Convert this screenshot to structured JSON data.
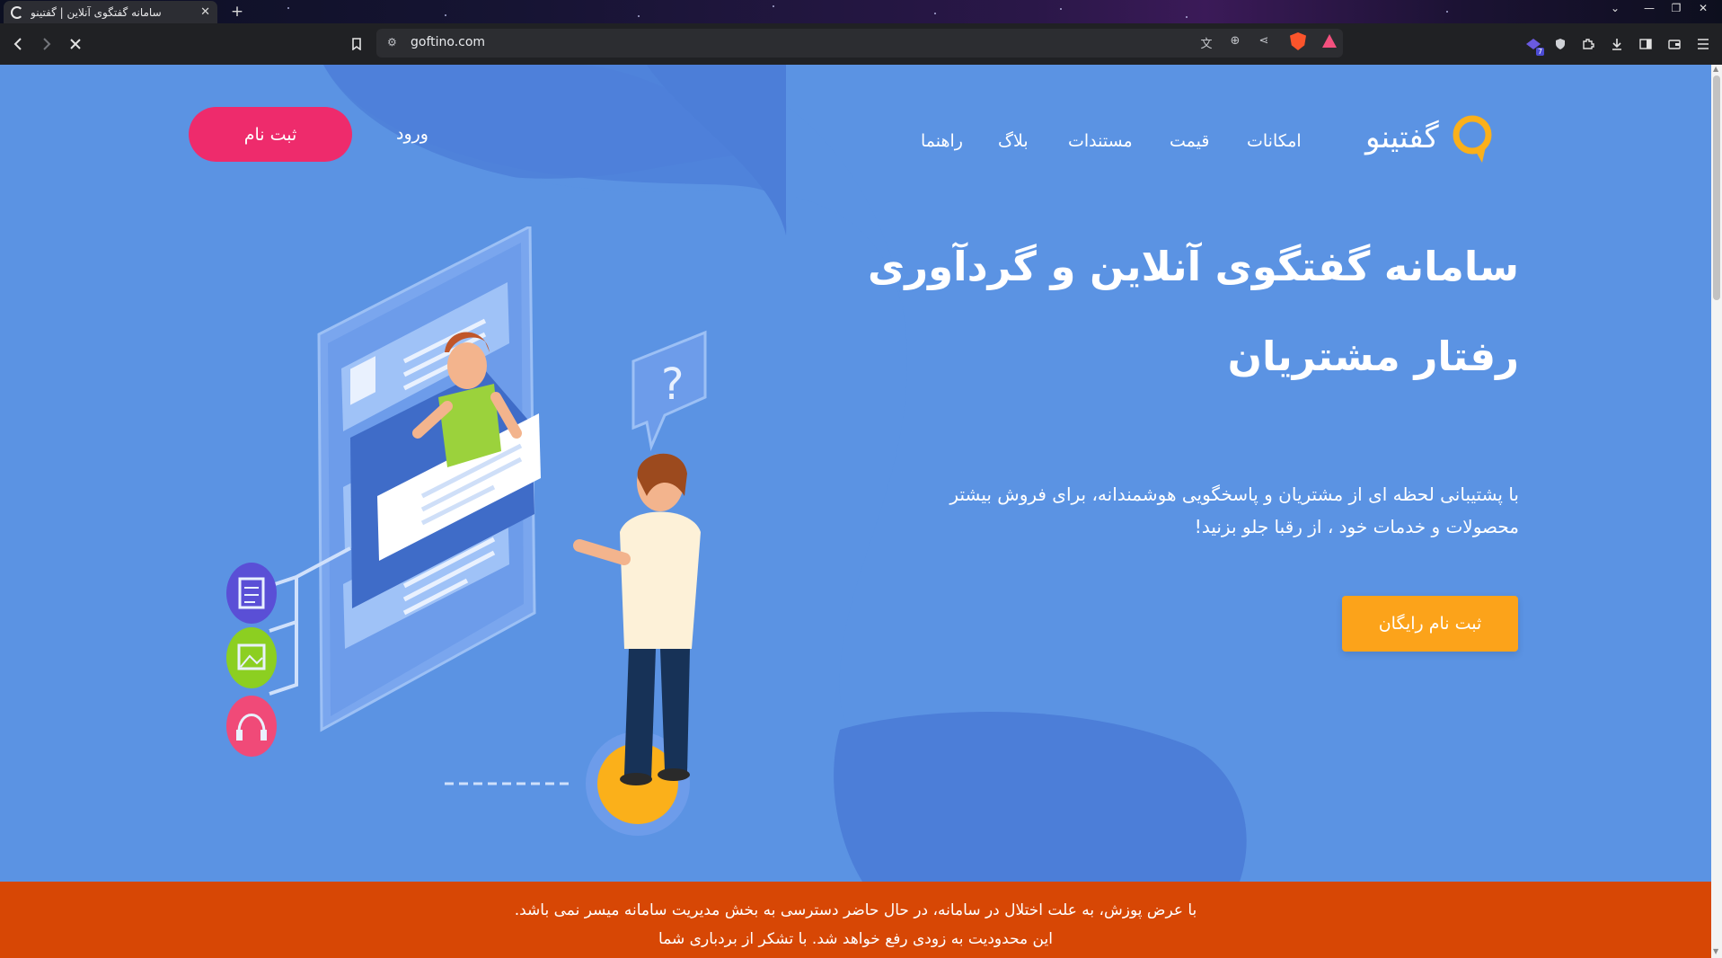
{
  "browser": {
    "tab_title": "سامانه گفتگوی آنلاین | گفتینو",
    "tab_close": "✕",
    "new_tab": "+",
    "url": "goftino.com",
    "extension_badge": "7",
    "window_controls": [
      "⌄",
      "—",
      "❐",
      "✕"
    ],
    "icons": [
      "back-icon",
      "forward-icon",
      "stop-icon",
      "bookmark-icon",
      "site-info-icon",
      "translate-icon",
      "zoom-icon",
      "share-icon",
      "brave-shield-icon",
      "brave-rewards-icon",
      "extensions-icon",
      "downloads-icon",
      "sidebar-icon",
      "wallet-icon",
      "menu-icon"
    ]
  },
  "nav": {
    "logo_text": "گفتینو",
    "items": [
      "امکانات",
      "قیمت",
      "مستندات",
      "بلاگ",
      "راهنما"
    ],
    "login": "ورود",
    "signup": "ثبت نام"
  },
  "hero": {
    "title_line1": "سامانه گفتگوی آنلاین و گردآوری",
    "title_line2": "رفتار مشتریان",
    "subtitle_line1": "با پشتیبانی لحظه ای از مشتریان و پاسخگویی هوشمندانه، برای فروش بیشتر",
    "subtitle_line2": "محصولات و خدمات خود ، از رقبا جلو بزنید!",
    "cta": "ثبت نام رایگان"
  },
  "illustration": {
    "question_mark": "?",
    "icons": [
      "document-icon",
      "image-icon",
      "headphones-icon"
    ]
  },
  "notice": {
    "line1": "با عرض پوزش، به علت اختلال در سامانه، در حال حاضر دسترسی به بخش مدیریت سامانه میسر نمی باشد.",
    "line2": "این محدودیت به زودی رفع خواهد شد. با تشکر از بردباری شما"
  },
  "colors": {
    "page_bg": "#5b93e3",
    "blob_dark": "#4c7ed8",
    "signup_button": "#ee2b6c",
    "cta_button": "#fca31a",
    "notice_bar": "#d74705",
    "logo_ring": "#fbb01a"
  }
}
